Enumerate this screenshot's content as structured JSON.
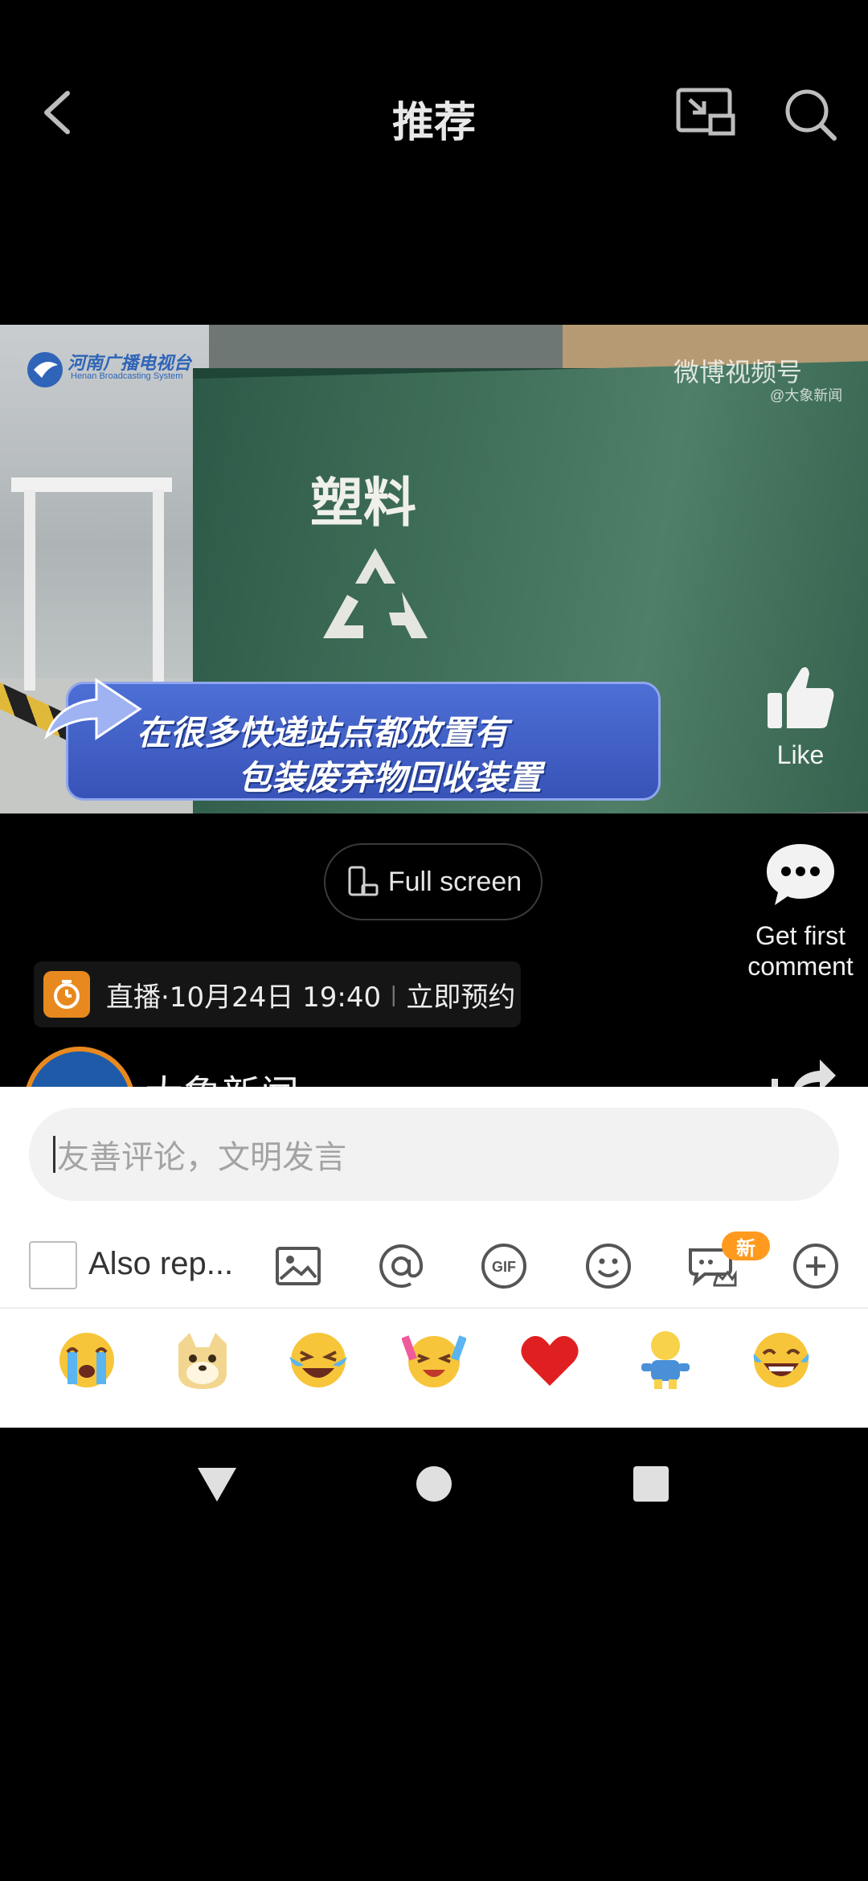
{
  "header": {
    "title": "推荐",
    "back_icon": "chevron-left-icon",
    "pip_icon": "picture-in-picture-icon",
    "search_icon": "search-icon"
  },
  "video": {
    "station_logo_text": "河南广播电视台",
    "station_logo_subtext": "Henan Broadcasting System",
    "scene_text": "塑料",
    "watermark": "微博视频号",
    "watermark_sub": "@大象新闻",
    "caption_line1": "在很多快递站点都放置有",
    "caption_line2": "包装废弃物回收装置",
    "like_label": "Like"
  },
  "fullscreen": {
    "label": "Full screen"
  },
  "comment_side": {
    "label_line1": "Get first",
    "label_line2": "comment"
  },
  "live_banner": {
    "text": "直播·10月24日 19:40",
    "separator": "|",
    "action": "立即预约"
  },
  "author": {
    "name": "大象新闻"
  },
  "comment_box": {
    "placeholder": "友善评论，文明发言",
    "also_repost_label": "Also rep...",
    "new_badge": "新",
    "tools": [
      "image-icon",
      "at-icon",
      "gif-icon",
      "emoji-icon",
      "chat-crown-icon",
      "plus-icon"
    ],
    "quick_emojis": [
      "crying-face",
      "doge",
      "laughing-tears",
      "excited-face",
      "red-heart",
      "little-man",
      "joy-face"
    ]
  },
  "colors": {
    "accent_orange": "#ff9a1f",
    "caption_blue": "#3853b8",
    "like_heart": "#e02020"
  }
}
